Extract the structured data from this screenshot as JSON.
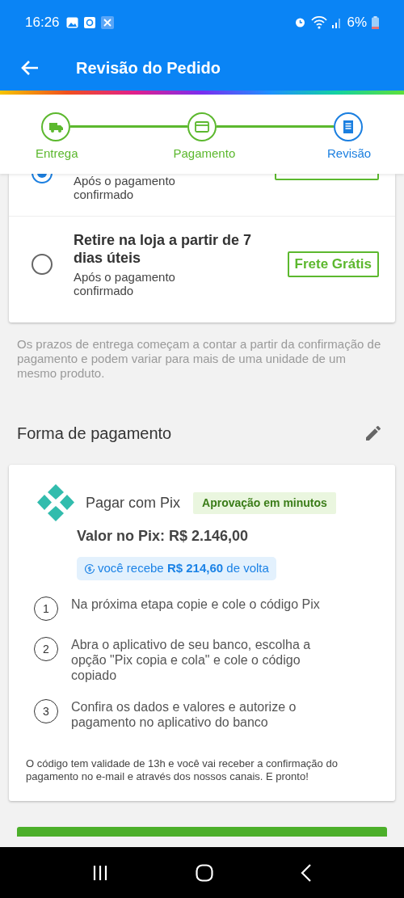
{
  "status_bar": {
    "time": "16:26",
    "battery": "6%"
  },
  "app_bar": {
    "title": "Revisão do Pedido"
  },
  "stepper": [
    {
      "label": "Entrega",
      "selected": false
    },
    {
      "label": "Pagamento",
      "selected": false
    },
    {
      "label": "Revisão",
      "selected": true
    }
  ],
  "delivery_options": [
    {
      "subtitle": "Após o pagamento confirmado",
      "selected": true
    },
    {
      "title": "Retire na loja a partir de 7 dias úteis",
      "subtitle": "Após o pagamento confirmado",
      "badge": "Frete Grátis",
      "selected": false
    }
  ],
  "delivery_note": "Os prazos de entrega começam a contar a partir da confirmação de pagamento e podem variar para mais de uma unidade de um mesmo produto.",
  "payment": {
    "heading": "Forma de pagamento",
    "method": "Pagar com Pix",
    "badge": "Aprovação em minutos",
    "value": "Valor no Pix: R$ 2.146,00",
    "cashback": "você recebe **R$ 214,60** de volta",
    "steps": [
      {
        "number": "1",
        "text": "Na próxima etapa copie e cole o código Pix"
      },
      {
        "number": "2",
        "text": "Abra o aplicativo de seu banco, escolha a opção \"Pix copia e cola\" e cole o código copiado"
      },
      {
        "number": "3",
        "text": "Confira os dados e valores e autorize o pagamento no aplicativo do banco"
      }
    ],
    "footer": "O código tem validade de 13h e você vai receber a confirmação do pagamento no e-mail e através dos nossos canais. E pronto!"
  }
}
